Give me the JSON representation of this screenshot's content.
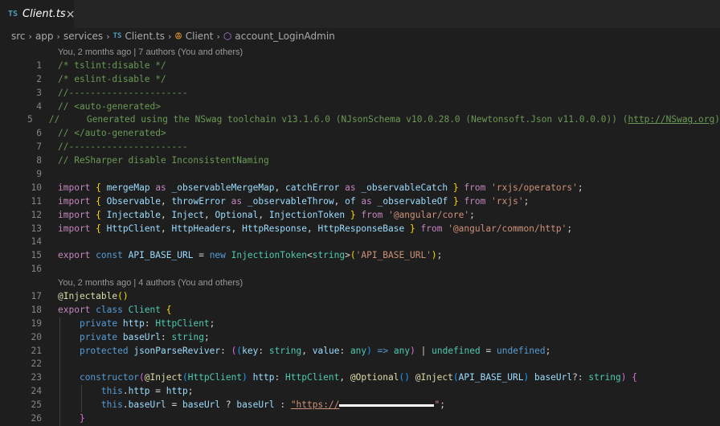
{
  "tab": {
    "badge": "TS",
    "label": "Client.ts",
    "close": "×"
  },
  "breadcrumb": {
    "items": [
      "src",
      "app",
      "services",
      "Client.ts",
      "Client",
      "account_LoginAdmin"
    ],
    "separator": "›",
    "ts_badge": "TS"
  },
  "codelens": {
    "first": "You, 2 months ago | 7 authors (You and others)",
    "second": "You, 2 months ago | 4 authors (You and others)"
  },
  "line_numbers": [
    "1",
    "2",
    "3",
    "4",
    "5",
    "6",
    "7",
    "8",
    "9",
    "10",
    "11",
    "12",
    "13",
    "14",
    "15",
    "16",
    "17",
    "18",
    "19",
    "20",
    "21",
    "22",
    "23",
    "24",
    "25",
    "26"
  ],
  "code": {
    "l1": "/* tslint:disable */",
    "l2": "/* eslint-disable */",
    "l3": "//----------------------",
    "l4": "// <auto-generated>",
    "l5a": "//     Generated using the NSwag toolchain v13.1.6.0 (NJsonSchema v10.0.28.0 (Newtonsoft.Json v11.0.0.0)) (",
    "l5url": "http://NSwag.org",
    "l5b": ")",
    "l6": "// </auto-generated>",
    "l7": "//----------------------",
    "l8": "// ReSharper disable InconsistentNaming",
    "imp": "import",
    "from": "from",
    "as": "as",
    "l10_1": "mergeMap",
    "l10_2": "_observableMergeMap",
    "l10_3": "catchError",
    "l10_4": "_observableCatch",
    "l10_s": "'rxjs/operators'",
    "l11_1": "Observable",
    "l11_2": "throwError",
    "l11_3": "_observableThrow",
    "l11_4": "of",
    "l11_5": "_observableOf",
    "l11_s": "'rxjs'",
    "l12_1": "Injectable",
    "l12_2": "Inject",
    "l12_3": "Optional",
    "l12_4": "InjectionToken",
    "l12_s": "'@angular/core'",
    "l13_1": "HttpClient",
    "l13_2": "HttpHeaders",
    "l13_3": "HttpResponse",
    "l13_4": "HttpResponseBase",
    "l13_s": "'@angular/common/http'",
    "export": "export",
    "const": "const",
    "new": "new",
    "class": "class",
    "private": "private",
    "protected": "protected",
    "constructor": "constructor",
    "this": "this",
    "undefined": "undefined",
    "string": "string",
    "any": "any",
    "api_const": "API_BASE_URL",
    "injection_token": "InjectionToken",
    "api_str": "'API_BASE_URL'",
    "decorator": "@Injectable",
    "class_name": "Client",
    "http": "http",
    "http_type": "HttpClient",
    "baseUrl": "baseUrl",
    "jsonParseReviver": "jsonParseReviver",
    "key": "key",
    "value": "value",
    "inject": "@Inject",
    "optional": "@Optional",
    "https": "\"https://",
    "quote_end": "\""
  }
}
